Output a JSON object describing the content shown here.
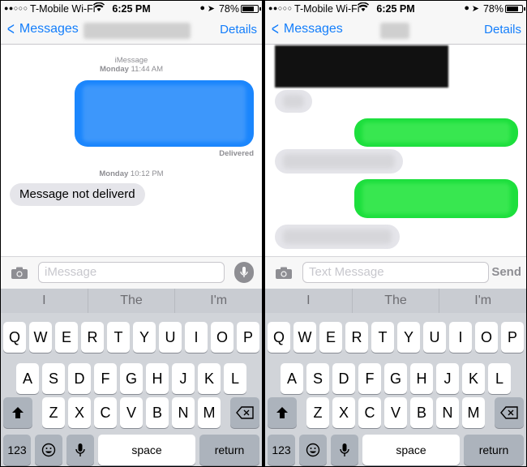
{
  "status_bar": {
    "signal": "●●○○○",
    "carrier": "T-Mobile Wi-Fi",
    "time": "6:25 PM",
    "battery": "78%"
  },
  "left": {
    "nav": {
      "back_label": "Messages",
      "details_label": "Details"
    },
    "service_label": "iMessage",
    "stamp1_day": "Monday",
    "stamp1_time": "11:44 AM",
    "delivered": "Delivered",
    "stamp2_day": "Monday",
    "stamp2_time": "10:12 PM",
    "incoming_text": "Message not deliverd",
    "input_placeholder": "iMessage"
  },
  "right": {
    "nav": {
      "back_label": "Messages",
      "details_label": "Details"
    },
    "input_placeholder": "Text Message",
    "send_label": "Send"
  },
  "keyboard": {
    "predictions": [
      "I",
      "The",
      "I'm"
    ],
    "row1": [
      "Q",
      "W",
      "E",
      "R",
      "T",
      "Y",
      "U",
      "I",
      "O",
      "P"
    ],
    "row2": [
      "A",
      "S",
      "D",
      "F",
      "G",
      "H",
      "J",
      "K",
      "L"
    ],
    "row3": [
      "Z",
      "X",
      "C",
      "V",
      "B",
      "N",
      "M"
    ],
    "numbers_label": "123",
    "space_label": "space",
    "return_label": "return"
  },
  "icons": [
    "signal-icon",
    "wifi-icon",
    "lock-icon",
    "location-icon",
    "battery-icon",
    "chevron-left-icon",
    "camera-icon",
    "microphone-icon",
    "shift-icon",
    "delete-icon",
    "emoji-icon",
    "dictation-icon"
  ],
  "colors": {
    "accent": "#147efb",
    "imessage_blue": "#1b86fd",
    "sms_green": "#1ddf3d",
    "incoming_gray": "#e5e5ea"
  }
}
